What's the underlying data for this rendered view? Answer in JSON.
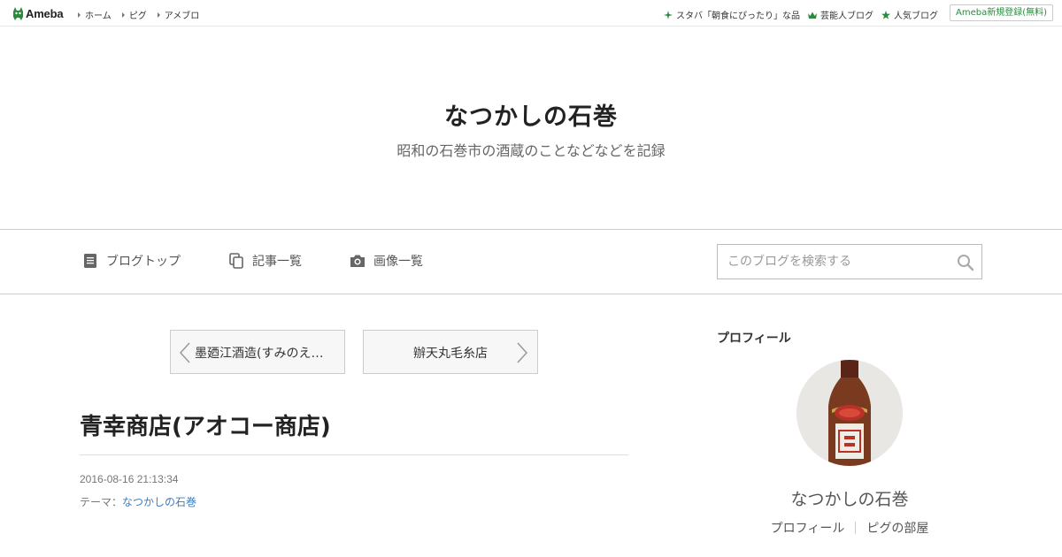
{
  "topbar": {
    "logo_text": "Ameba",
    "left_links": [
      "ホーム",
      "ピグ",
      "アメブロ"
    ],
    "right_links": [
      {
        "icon": "sparkle-icon",
        "label": "スタバ「朝食にぴったり」な品"
      },
      {
        "icon": "crown-icon",
        "label": "芸能人ブログ"
      },
      {
        "icon": "star-icon",
        "label": "人気ブログ"
      }
    ],
    "register_label": "Ameba新規登録(無料)",
    "accent_color": "#2b8a3e"
  },
  "header": {
    "title": "なつかしの石巻",
    "description": "昭和の石巻市の酒蔵のことなどなどを記録"
  },
  "nav": {
    "items": [
      {
        "icon": "document-icon",
        "label": "ブログトップ"
      },
      {
        "icon": "copy-icon",
        "label": "記事一覧"
      },
      {
        "icon": "camera-icon",
        "label": "画像一覧"
      }
    ],
    "search_placeholder": "このブログを検索する"
  },
  "article": {
    "prev_label": "墨廼江酒造(すみのえ…",
    "next_label": "辦天丸毛糸店",
    "title": "青幸商店(アオコー商店)",
    "date": "2016-08-16 21:13:34",
    "theme_prefix": "テーマ：",
    "theme": "なつかしの石巻"
  },
  "sidebar": {
    "heading": "プロフィール",
    "name": "なつかしの石巻",
    "links": [
      "プロフィール",
      "ピグの部屋"
    ]
  }
}
